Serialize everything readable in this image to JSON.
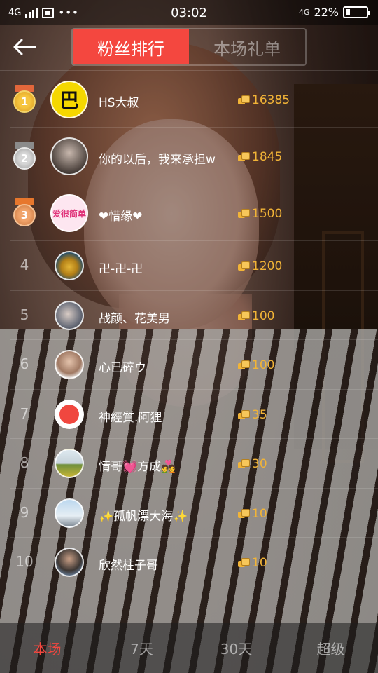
{
  "status_bar": {
    "network_left": "4G",
    "time": "03:02",
    "network_right": "4G",
    "battery_percent_text": "22%",
    "battery_level": 0.22
  },
  "header": {
    "tabs": [
      {
        "label": "粉丝排行",
        "active": true
      },
      {
        "label": "本场礼单",
        "active": false
      }
    ]
  },
  "ranking": [
    {
      "rank": "1",
      "name": "HS大叔",
      "score": "16385",
      "avatar": "logo-avatar"
    },
    {
      "rank": "2",
      "name": "你的以后，我来承担w",
      "score": "1845",
      "avatar": "person-avatar"
    },
    {
      "rank": "3",
      "name": "❤惜缘❤",
      "score": "1500",
      "avatar": "text-avatar"
    },
    {
      "rank": "4",
      "name": "卍-卍-卍",
      "score": "1200",
      "avatar": "statue-avatar"
    },
    {
      "rank": "5",
      "name": "战颜、花美男",
      "score": "100",
      "avatar": "person-avatar"
    },
    {
      "rank": "6",
      "name": "心已碎ウ",
      "score": "100",
      "avatar": "person-avatar"
    },
    {
      "rank": "7",
      "name": "神經質.阿狸",
      "score": "35",
      "avatar": "fox-avatar"
    },
    {
      "rank": "8",
      "name": "情哥💓方成💑",
      "score": "30",
      "avatar": "landscape-avatar"
    },
    {
      "rank": "9",
      "name": "✨孤帆漂大海✨",
      "score": "10",
      "avatar": "tower-avatar"
    },
    {
      "rank": "10",
      "name": "欣然柱子哥",
      "score": "10",
      "avatar": "person-avatar"
    }
  ],
  "avatar_text": {
    "logo": "巴",
    "text": "爱很简单"
  },
  "bottom_tabs": [
    {
      "label": "本场",
      "active": true
    },
    {
      "label": "7天",
      "active": false
    },
    {
      "label": "30天",
      "active": false
    },
    {
      "label": "超级",
      "active": false
    }
  ],
  "colors": {
    "accent": "#f4473f",
    "score": "#f2b437",
    "gold": "#f6c53f",
    "silver": "#d6d6d6",
    "bronze": "#f0a36a"
  }
}
